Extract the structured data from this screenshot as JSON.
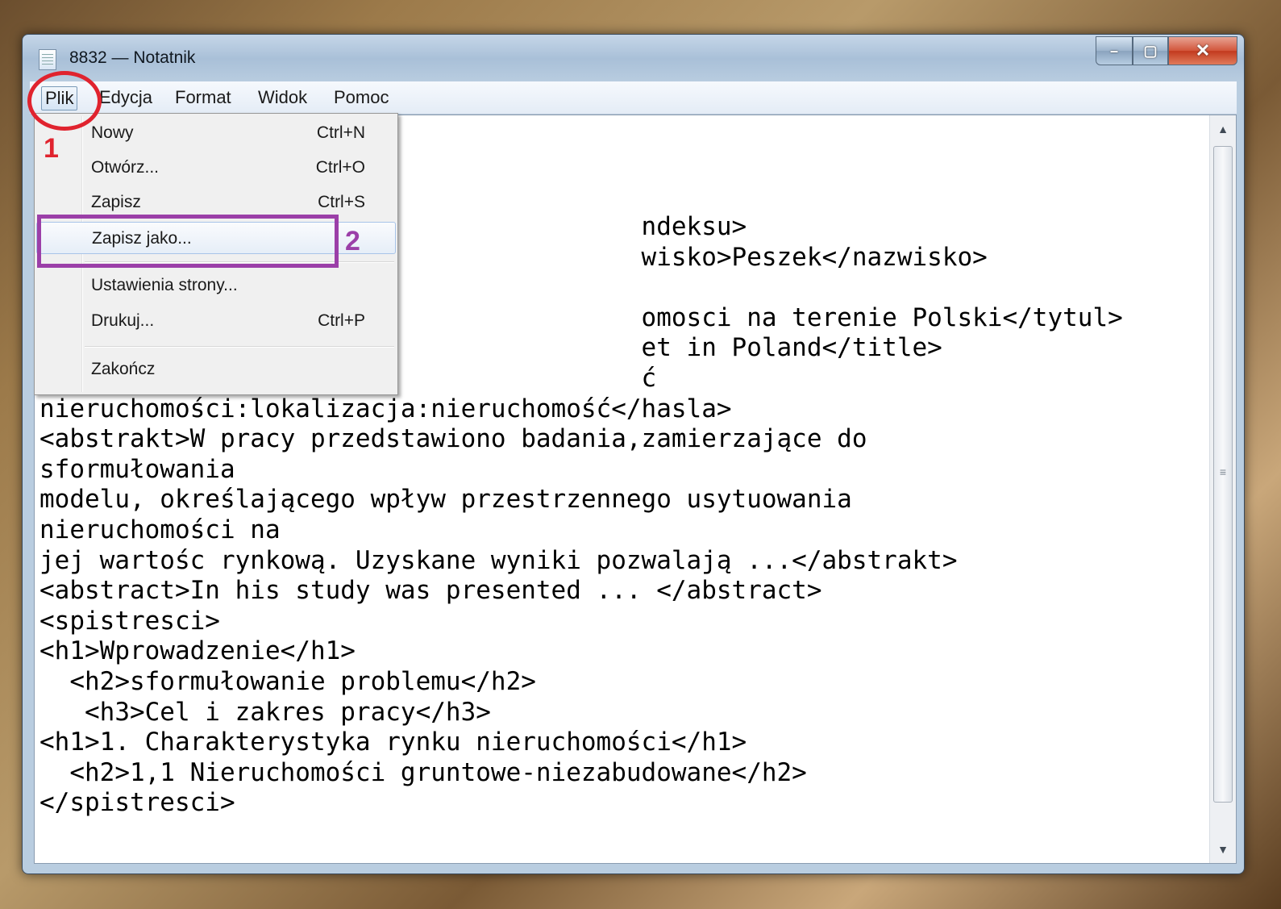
{
  "window": {
    "title": "8832 — Notatnik",
    "caption_buttons": {
      "minimize": "–",
      "maximize": "▢",
      "close": "✕"
    }
  },
  "menubar": {
    "items": [
      "Plik",
      "Edycja",
      "Format",
      "Widok",
      "Pomoc"
    ],
    "active": "Plik"
  },
  "file_menu": [
    {
      "label": "Nowy",
      "shortcut": "Ctrl+N"
    },
    {
      "label": "Otwórz...",
      "shortcut": "Ctrl+O"
    },
    {
      "label": "Zapisz",
      "shortcut": "Ctrl+S"
    },
    {
      "label": "Zapisz jako...",
      "shortcut": ""
    },
    {
      "label": "Ustawienia strony...",
      "shortcut": ""
    },
    {
      "label": "Drukuj...",
      "shortcut": "Ctrl+P"
    },
    {
      "label": "Zakończ",
      "shortcut": ""
    }
  ],
  "editor": {
    "lines": [
      "                                        ndeksu>",
      "                                        wisko>Peszek</nazwisko>",
      "",
      "                                        omosci na terenie Polski</tytul>",
      "                                        et in Poland</title>",
      "                                        ć",
      "nieruchomości:lokalizacja:nieruchomość</hasla>",
      "<abstrakt>W pracy przedstawiono badania,zamierzające do",
      "sformułowania",
      "modelu, określającego wpływ przestrzennego usytuowania",
      "nieruchomości na",
      "jej wartośc rynkową. Uzyskane wyniki pozwalają ...</abstrakt>",
      "<abstract>In his study was presented ... </abstract>",
      "<spistresci>",
      "<h1>Wprowadzenie</h1>",
      "  <h2>sformułowanie problemu</h2>",
      "   <h3>Cel i zakres pracy</h3>",
      "<h1>1. Charakterystyka rynku nieruchomości</h1>",
      "  <h2>1,1 Nieruchomości gruntowe-niezabudowane</h2>",
      "</spistresci>"
    ]
  },
  "scrollbar": {
    "up": "▲",
    "down": "▼",
    "grip": "≡"
  },
  "annotations": {
    "step1": "1",
    "step2": "2",
    "step1_color": "#e0232e",
    "step2_color": "#9b3fa8"
  }
}
